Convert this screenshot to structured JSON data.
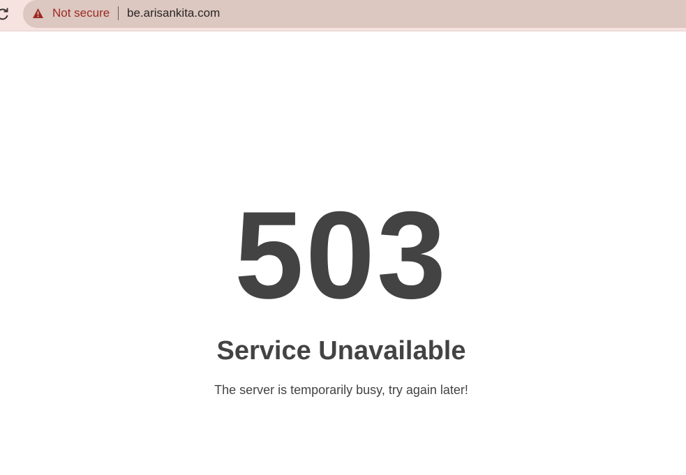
{
  "browser": {
    "security_label": "Not secure",
    "url": "be.arisankita.com",
    "icons": {
      "reload": "reload-icon",
      "warning": "warning-triangle-icon"
    },
    "colors": {
      "toolbar": "#f6e3df",
      "omnibox": "#dcc7c1",
      "warning": "#9c2a22"
    }
  },
  "error": {
    "code": "503",
    "title": "Service Unavailable",
    "message": "The server is temporarily busy, try again later!",
    "text_color": "#434343"
  }
}
